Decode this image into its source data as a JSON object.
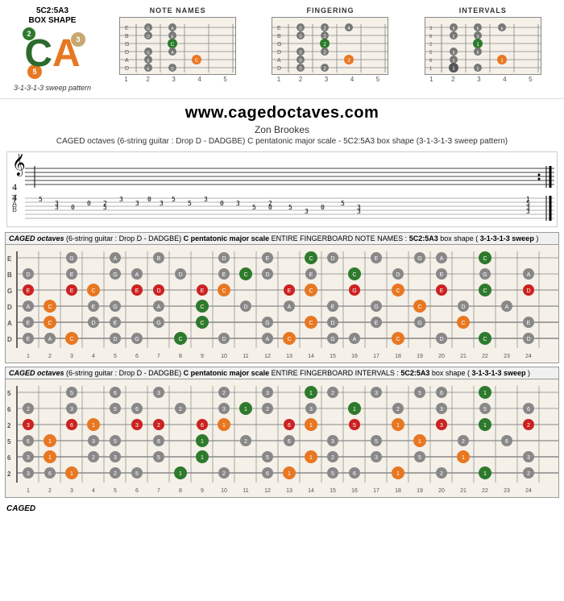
{
  "page": {
    "title": "CAGED octaves - 5C2:5A3 box shape",
    "url": "www.cagedoctaves.com",
    "author": "Zon Brookes",
    "description": "CAGED octaves (6-string guitar : Drop D - DADGBE) C pentatonic major scale - 5C2:5A3 box shape (3-1-3-1-3 sweep pattern)",
    "boxShape": "5C2:5A3",
    "boxShapeLabel": "BOX SHAPE",
    "sweepPattern": "3-1-3-1-3 sweep pattern"
  },
  "topDiagrams": [
    {
      "title": "NOTE NAMES"
    },
    {
      "title": "FINGERING"
    },
    {
      "title": "INTERVALS"
    }
  ],
  "fingerboard1": {
    "headerItalic": "CAGED octaves",
    "headerNormal": " (6-string guitar : Drop D - DADGBE) ",
    "headerBold": "C pentatonic major scale",
    "headerNormal2": " ENTIRE FINGERBOARD NOTE NAMES : ",
    "headerBold2": "5C2:5A3",
    "headerNormal3": " box shape (",
    "headerBold3": "3-1-3-1-3 sweep",
    "headerNormal4": ")",
    "fretNumbers": [
      "1",
      "2",
      "3",
      "4",
      "5",
      "6",
      "7",
      "8",
      "9",
      "10",
      "11",
      "12",
      "13",
      "14",
      "15",
      "16",
      "17",
      "18",
      "19",
      "20",
      "21",
      "22",
      "23",
      "24"
    ]
  },
  "fingerboard2": {
    "headerItalic": "CAGED octaves",
    "headerNormal": " (6-string guitar : Drop D - DADGBE) ",
    "headerBold": "C pentatonic major scale",
    "headerNormal2": " ENTIRE FINGERBOARD INTERVALS : ",
    "headerBold2": "5C2:5A3",
    "headerNormal3": " box shape (",
    "headerBold3": "3-1-3-1-3 sweep",
    "headerNormal4": ")",
    "fretNumbers": [
      "1",
      "2",
      "3",
      "4",
      "5",
      "6",
      "7",
      "8",
      "9",
      "10",
      "11",
      "12",
      "13",
      "14",
      "15",
      "16",
      "17",
      "18",
      "19",
      "20",
      "21",
      "22",
      "23",
      "24"
    ]
  },
  "caged_label": "CAGED",
  "logoLetters": {
    "c": "C",
    "a": "A"
  },
  "logoBadges": {
    "two": "2",
    "five": "5",
    "three": "3"
  }
}
